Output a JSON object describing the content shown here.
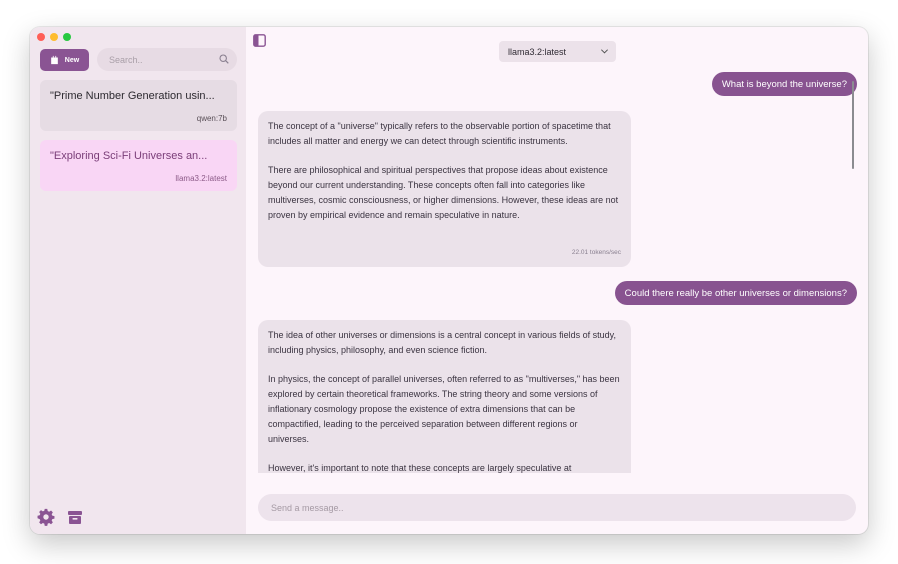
{
  "sidebar": {
    "new_label": "New",
    "search_placeholder": "Search..",
    "conversations": [
      {
        "title": "\"Prime Number Generation usin...",
        "model": "qwen:7b",
        "active": false
      },
      {
        "title": "\"Exploring Sci-Fi Universes an...",
        "model": "llama3.2:latest",
        "active": true
      }
    ]
  },
  "header": {
    "model_selected": "llama3.2:latest"
  },
  "messages": [
    {
      "role": "user",
      "text": "What is beyond the universe?"
    },
    {
      "role": "assistant",
      "paragraphs": [
        "The concept of a \"universe\" typically refers to the observable portion of spacetime that includes all matter and energy we can detect through scientific instruments.",
        "There are philosophical and spiritual perspectives that propose ideas about existence beyond our current understanding. These concepts often fall into categories like multiverses, cosmic consciousness, or higher dimensions. However, these ideas are not proven by empirical evidence and remain speculative in nature."
      ],
      "tokens_per_sec": "22.01 tokens/sec"
    },
    {
      "role": "user",
      "text": "Could there really be other universes or dimensions?"
    },
    {
      "role": "assistant",
      "paragraphs": [
        "The idea of other universes or dimensions is a central concept in various fields of study, including physics, philosophy, and even science fiction.",
        "In physics, the concept of parallel universes, often referred to as \"multiverses,\" has been explored by certain theoretical frameworks. The string theory and some versions of inflationary cosmology propose the existence of extra dimensions that can be compactified, leading to the perceived separation between different regions or universes.",
        "However, it's important to note that these concepts are largely speculative at"
      ]
    }
  ],
  "composer": {
    "placeholder": "Send a message.."
  },
  "colors": {
    "accent": "#885390",
    "active_conversation": "#f9d6f5",
    "sidebar_bg": "#f1e6ee",
    "assistant_bubble": "#ebe2ea"
  },
  "icons": {
    "new": "new-chat-icon",
    "search": "search-icon",
    "settings": "gear-icon",
    "archive": "archive-icon",
    "sidebar_toggle": "sidebar-toggle-icon",
    "dropdown": "chevron-down-icon"
  }
}
